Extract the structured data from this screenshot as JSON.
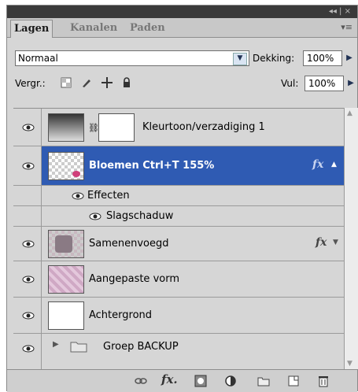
{
  "titlebar": {
    "controls": "◂◂ | ×"
  },
  "tabs": [
    {
      "label": "Lagen",
      "active": true
    },
    {
      "label": "Kanalen",
      "active": false
    },
    {
      "label": "Paden",
      "active": false
    }
  ],
  "blend": {
    "mode": "Normaal",
    "opacity_label": "Dekking:",
    "opacity_value": "100%"
  },
  "lock": {
    "label": "Vergr.:",
    "fill_label": "Vul:",
    "fill_value": "100%"
  },
  "layers": [
    {
      "name": "Kleurtoon/verzadiging 1",
      "type": "adjustment"
    },
    {
      "name": "Bloemen Ctrl+T 155%",
      "type": "image",
      "selected": true,
      "fx": "fx"
    },
    {
      "name": "Effecten",
      "type": "effects-group"
    },
    {
      "name": "Slagschaduw",
      "type": "effect"
    },
    {
      "name": "Samenenvoegd",
      "type": "image",
      "fx": "fx"
    },
    {
      "name": "Aangepaste vorm",
      "type": "shape"
    },
    {
      "name": "Achtergrond",
      "type": "background"
    },
    {
      "name": "Groep BACKUP",
      "type": "group"
    }
  ],
  "colors": {
    "selection": "#2f5bb3",
    "panel": "#d6d6d6"
  },
  "footer_icons": [
    "link-icon",
    "fx-icon",
    "mask-icon",
    "adjustment-icon",
    "folder-icon",
    "new-layer-icon",
    "trash-icon"
  ]
}
